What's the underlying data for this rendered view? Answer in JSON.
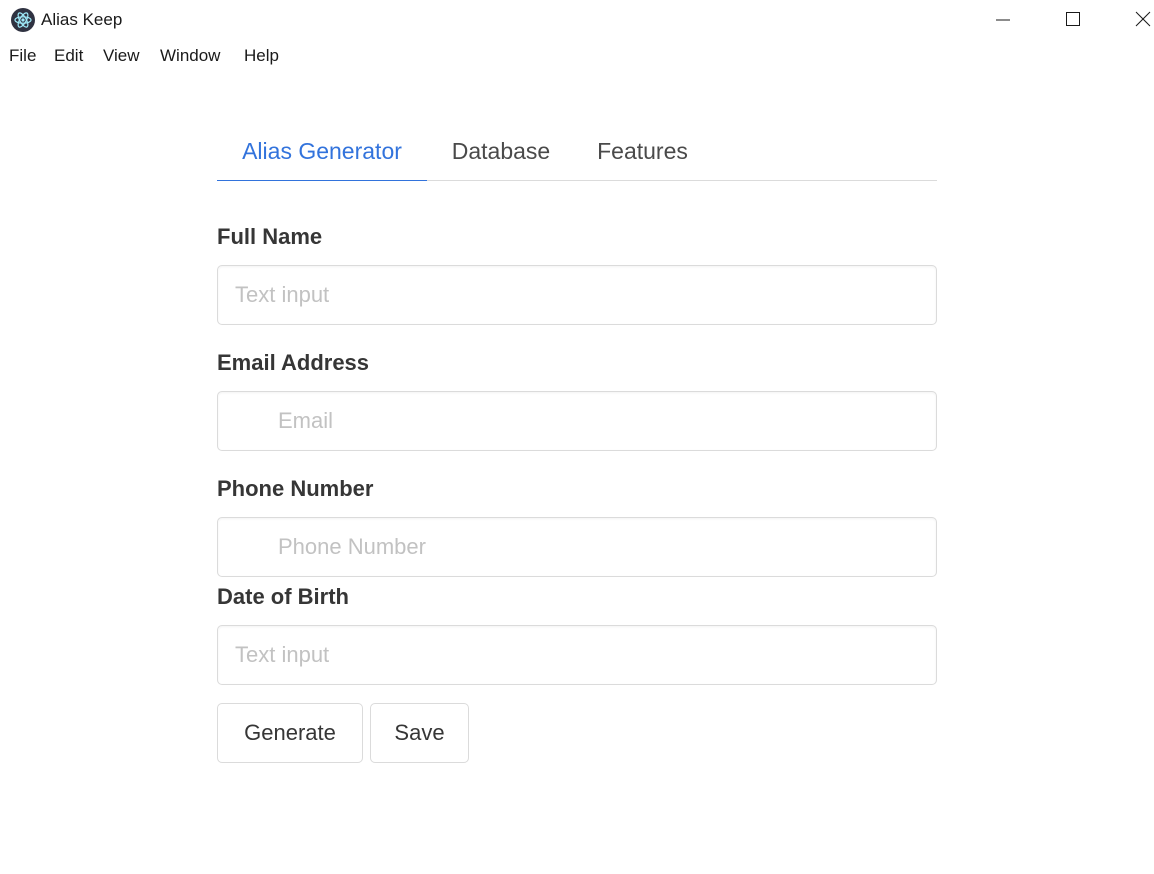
{
  "window": {
    "title": "Alias Keep",
    "icon": "electron-atom-icon",
    "controls": [
      "minimize",
      "maximize",
      "close"
    ]
  },
  "menu": {
    "items": [
      "File",
      "Edit",
      "View",
      "Window",
      "Help"
    ]
  },
  "tabs": [
    {
      "label": "Alias Generator",
      "active": true
    },
    {
      "label": "Database",
      "active": false
    },
    {
      "label": "Features",
      "active": false
    }
  ],
  "form": {
    "full_name": {
      "label": "Full Name",
      "value": "",
      "placeholder": "Text input"
    },
    "email": {
      "label": "Email Address",
      "value": "",
      "placeholder": "Email"
    },
    "phone": {
      "label": "Phone Number",
      "value": "",
      "placeholder": "Phone Number"
    },
    "dob": {
      "label": "Date of Birth",
      "value": "",
      "placeholder": "Text input"
    }
  },
  "buttons": {
    "generate": "Generate",
    "save": "Save"
  },
  "colors": {
    "accent": "#3273dc",
    "border": "#dbdbdb",
    "text": "#363636",
    "placeholder": "#c2c2c2"
  }
}
